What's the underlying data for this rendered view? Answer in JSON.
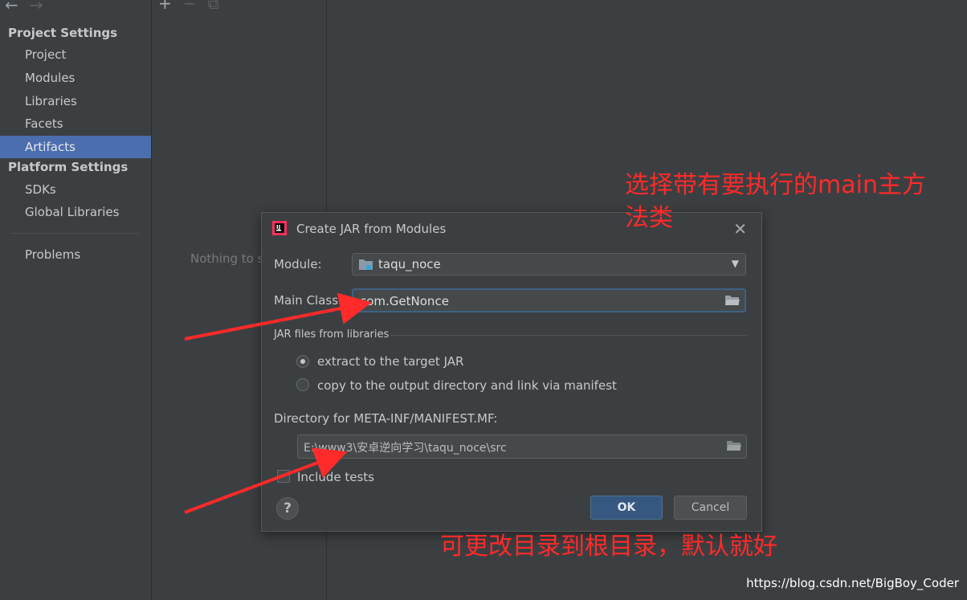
{
  "sidebar": {
    "project_settings_title": "Project Settings",
    "platform_settings_title": "Platform Settings",
    "project_items": [
      "Project",
      "Modules",
      "Libraries",
      "Facets",
      "Artifacts"
    ],
    "platform_items": [
      "SDKs",
      "Global Libraries"
    ],
    "problems": "Problems",
    "selected_item": "Artifacts"
  },
  "middle": {
    "placeholder": "Nothing to s"
  },
  "dialog": {
    "title": "Create JAR from Modules",
    "module_label": "Module:",
    "module_value": "taqu_noce",
    "main_class_label": "Main Class:",
    "main_class_value": "com.GetNonce",
    "jar_group_label": "JAR files from libraries",
    "radio_extract": "extract to the target JAR",
    "radio_copy": "copy to the output directory and link via manifest",
    "selected_radio": "extract to the target JAR",
    "directory_label": "Directory for META-INF/MANIFEST.MF:",
    "directory_value": "E:\\www3\\安卓逆向学习\\taqu_noce\\src",
    "include_tests_label": "Include tests",
    "include_tests_checked": false,
    "ok_label": "OK",
    "cancel_label": "Cancel",
    "help_label": "?"
  },
  "annotations": {
    "top_line1": "选择带有要执行的main主方",
    "top_line2": "法类",
    "bottom": "可更改目录到根目录，默认就好",
    "color": "#ff2a2a"
  },
  "watermark": "https://blog.csdn.net/BigBoy_Coder",
  "colors": {
    "accent": "#4b6eaf",
    "ok_button": "#365880",
    "focus_border": "#3d6185"
  }
}
